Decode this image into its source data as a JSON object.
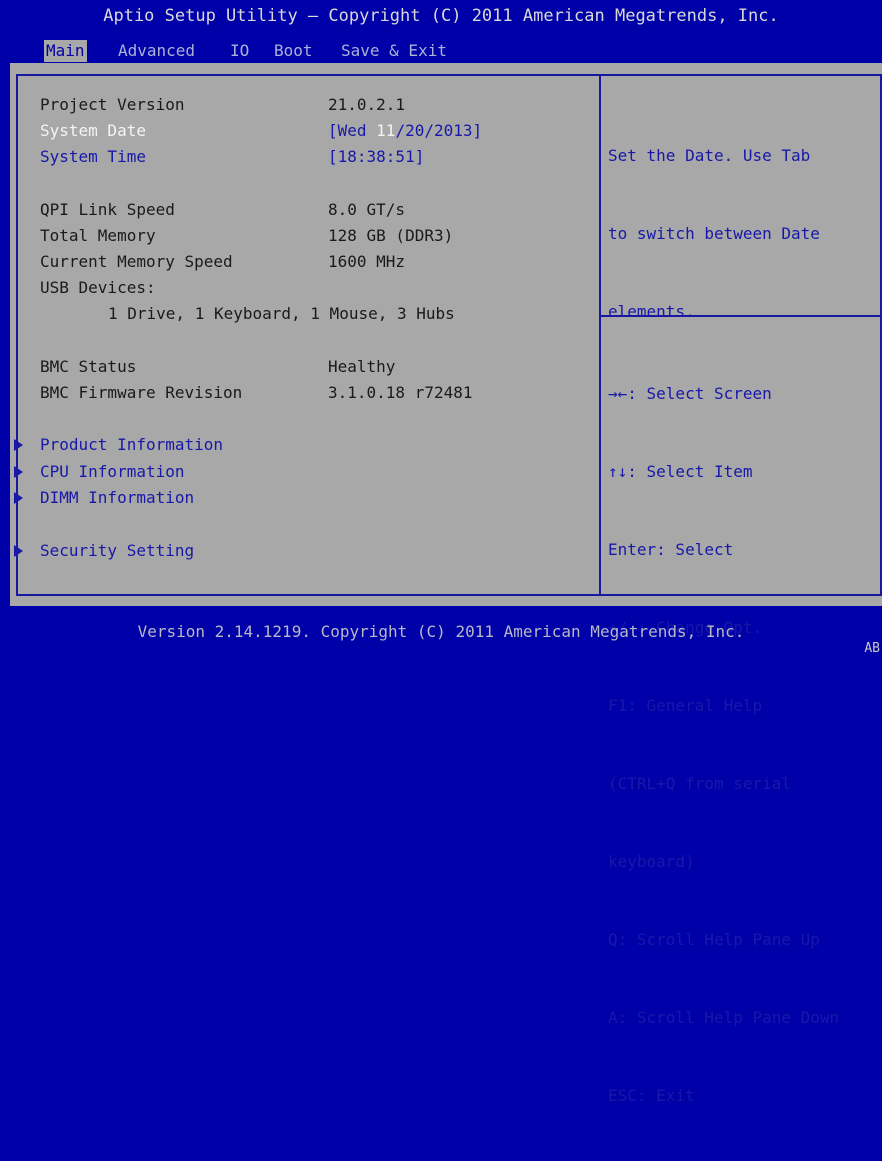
{
  "title": "Aptio Setup Utility – Copyright (C) 2011 American Megatrends, Inc.",
  "tabs": [
    "Main",
    "Advanced",
    "IO",
    "Boot",
    "Save & Exit"
  ],
  "active_tab": "Main",
  "info": {
    "project_version": {
      "label": "Project Version",
      "value": "21.0.2.1"
    },
    "system_date": {
      "label": "System Date",
      "value_prefix": "[Wed ",
      "value_highlight": "11",
      "value_suffix": "/20/2013]"
    },
    "system_time": {
      "label": "System Time",
      "value": "[18:38:51]"
    },
    "qpi": {
      "label": "QPI Link Speed",
      "value": "8.0 GT/s"
    },
    "total_memory": {
      "label": "Total Memory",
      "value": "128 GB (DDR3)"
    },
    "mem_speed": {
      "label": "Current Memory Speed",
      "value": "1600 MHz"
    },
    "usb_label": "USB Devices:",
    "usb_value": "1 Drive, 1 Keyboard, 1 Mouse, 3 Hubs",
    "bmc_status": {
      "label": "BMC Status",
      "value": "Healthy"
    },
    "bmc_fw": {
      "label": "BMC Firmware Revision",
      "value": "3.1.0.18 r72481"
    }
  },
  "submenus": [
    "Product Information",
    "CPU Information",
    "DIMM Information",
    "Security Setting"
  ],
  "help_text": [
    "Set the Date. Use Tab",
    "to switch between Date",
    "elements."
  ],
  "keys": [
    "→←: Select Screen",
    "↑↓: Select Item",
    "Enter: Select",
    "+/-: Change Opt.",
    "F1: General Help",
    "(CTRL+Q from serial",
    "keyboard)",
    "Q: Scroll Help Pane Up",
    "A: Scroll Help Pane Down",
    "ESC: Exit"
  ],
  "footer": {
    "version": "Version 2.14.1219. Copyright (C) 2011 American Megatrends, Inc.",
    "corner": "AB"
  },
  "colors": {
    "background": "#0000a8",
    "panel": "#a8a8a8",
    "link": "#1818a8",
    "selected": "#f4f4f4"
  }
}
